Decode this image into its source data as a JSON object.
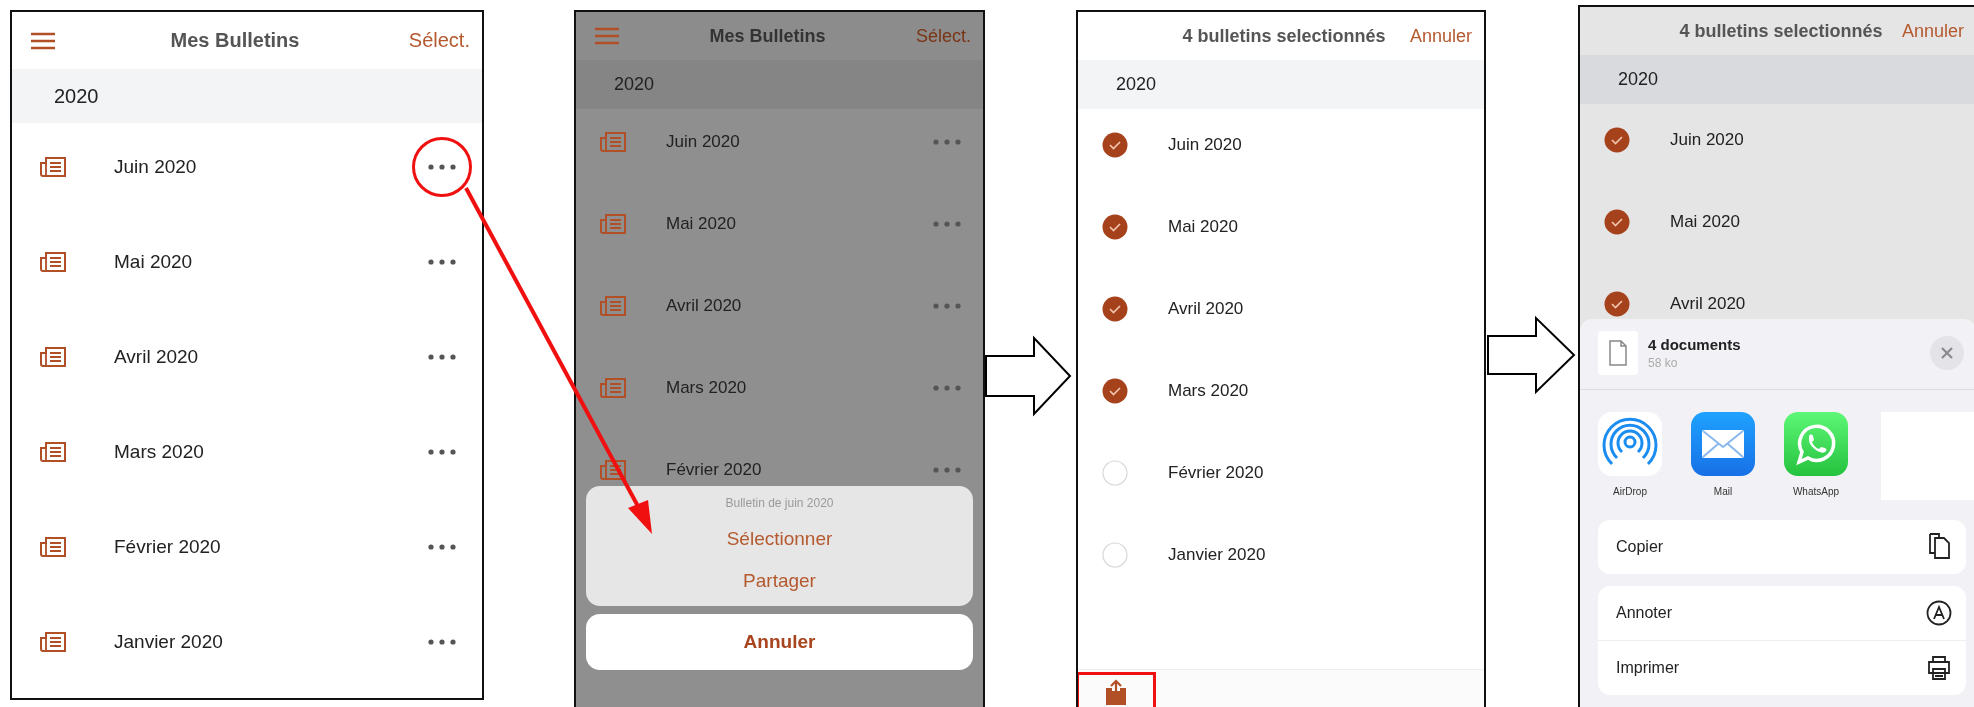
{
  "screens": [
    {
      "kind": "list",
      "dimmed": false,
      "title": "Mes Bulletins",
      "action": "Sélect.",
      "section": "2020",
      "rows": [
        {
          "label": "Juin 2020",
          "highlighted": true
        },
        {
          "label": "Mai 2020",
          "highlighted": false
        },
        {
          "label": "Avril 2020",
          "highlighted": false
        },
        {
          "label": "Mars 2020",
          "highlighted": false
        },
        {
          "label": "Février 2020",
          "highlighted": false
        },
        {
          "label": "Janvier 2020",
          "highlighted": false
        }
      ]
    },
    {
      "kind": "list",
      "dimmed": true,
      "title": "Mes Bulletins",
      "action": "Sélect.",
      "section": "2020",
      "rows": [
        {
          "label": "Juin 2020",
          "highlighted": false
        },
        {
          "label": "Mai 2020",
          "highlighted": false
        },
        {
          "label": "Avril 2020",
          "highlighted": false
        },
        {
          "label": "Mars 2020",
          "highlighted": false
        },
        {
          "label": "Février 2020",
          "highlighted": false
        }
      ],
      "action_sheet": {
        "title": "Bulletin de juin 2020",
        "actions": [
          "Sélectionner",
          "Partager"
        ],
        "cancel": "Annuler"
      }
    },
    {
      "kind": "select",
      "dimmed": false,
      "title": "4 bulletins selectionnés",
      "action": "Annuler",
      "section": "2020",
      "rows": [
        {
          "label": "Juin 2020",
          "checked": true
        },
        {
          "label": "Mai 2020",
          "checked": true
        },
        {
          "label": "Avril 2020",
          "checked": true
        },
        {
          "label": "Mars 2020",
          "checked": true
        },
        {
          "label": "Février 2020",
          "checked": false
        },
        {
          "label": "Janvier 2020",
          "checked": false
        }
      ],
      "toolbar": {
        "share_highlighted": true
      }
    },
    {
      "kind": "select",
      "dimmed": true,
      "title": "4 bulletins selectionnés",
      "action": "Annuler",
      "section": "2020",
      "rows": [
        {
          "label": "Juin 2020",
          "checked": true
        },
        {
          "label": "Mai 2020",
          "checked": true
        },
        {
          "label": "Avril 2020",
          "checked": true
        }
      ],
      "share_sheet": {
        "title": "4 documents",
        "subtitle": "58 ko",
        "apps": [
          {
            "kind": "airdrop",
            "label": "AirDrop"
          },
          {
            "kind": "mail",
            "label": "Mail"
          },
          {
            "kind": "whatsapp",
            "label": "WhatsApp"
          }
        ],
        "groups": [
          [
            {
              "kind": "copy",
              "label": "Copier"
            }
          ],
          [
            {
              "kind": "markup",
              "label": "Annoter"
            },
            {
              "kind": "print",
              "label": "Imprimer"
            }
          ]
        ]
      }
    }
  ]
}
